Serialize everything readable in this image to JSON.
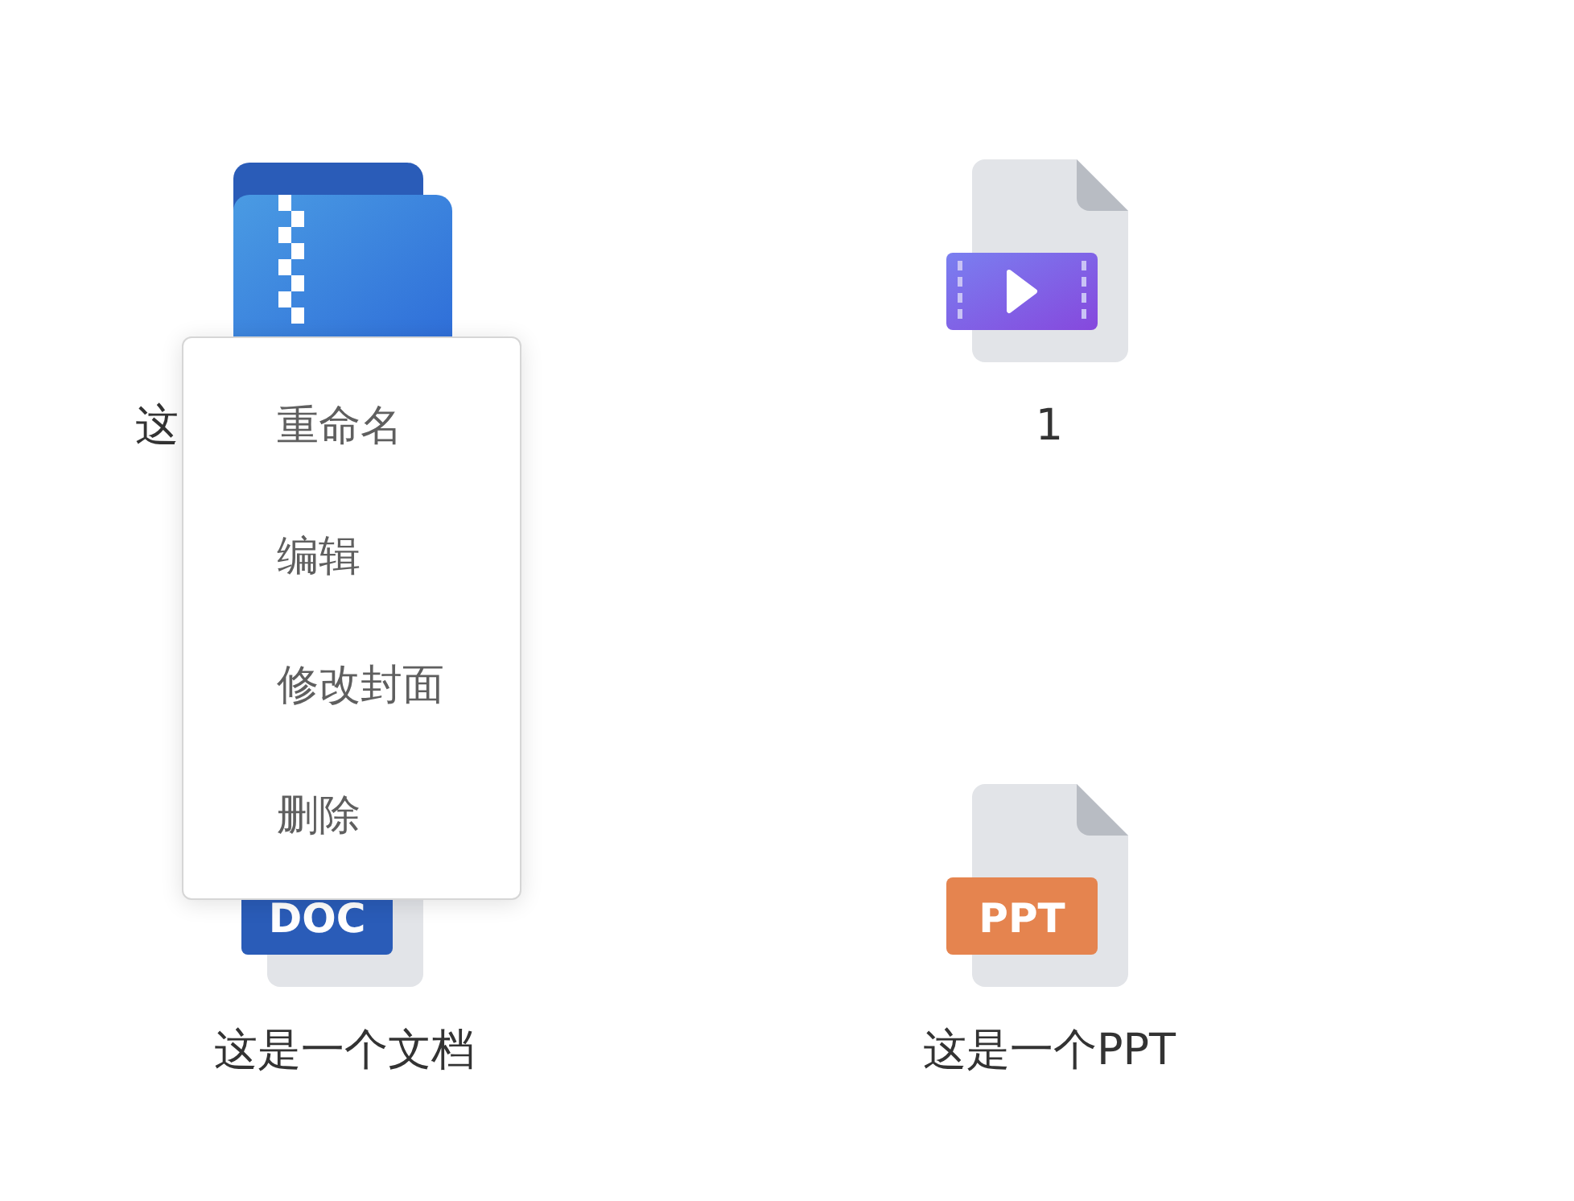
{
  "files": [
    {
      "kind": "zip",
      "name": "这",
      "cut_off": true
    },
    {
      "kind": "video",
      "name": "1"
    },
    {
      "kind": "doc",
      "badge": "DOC",
      "name": "这是一个文档"
    },
    {
      "kind": "ppt",
      "badge": "PPT",
      "name": "这是一个PPT"
    }
  ],
  "context_menu": {
    "items": [
      "重命名",
      "编辑",
      "修改封面",
      "删除"
    ]
  }
}
